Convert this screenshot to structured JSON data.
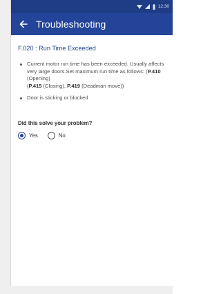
{
  "status_bar": {
    "time": "12:30"
  },
  "app_bar": {
    "title": "Troubleshooting"
  },
  "error": {
    "title": "F.020 : Run Time Exceeded"
  },
  "bullets": [
    {
      "parts": [
        "Current motor run time has been exceeded. Usually affects very large doors.Set maximum run time as follows: (",
        "P.410",
        " (Opening)",
        "P.415",
        " (Closing), ",
        "P.419",
        " (Deadman move))"
      ]
    },
    {
      "text": "Door is sticking or blocked"
    }
  ],
  "question": "Did this solve your problem?",
  "options": [
    {
      "label": "Yes",
      "selected": true
    },
    {
      "label": "No",
      "selected": false
    }
  ],
  "colors": {
    "primary": "#24449a",
    "status": "#1f3c86",
    "title_text": "#1e3f8f"
  }
}
